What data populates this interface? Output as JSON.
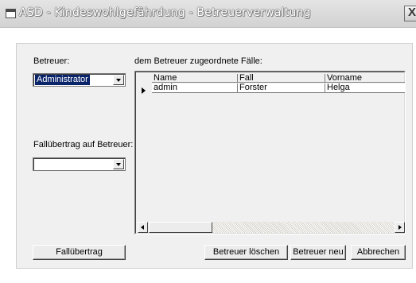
{
  "window": {
    "title": "ASD - Kindeswohlgefährdung - Betreuerverwaltung",
    "close_glyph": "X"
  },
  "left": {
    "betreuer_label": "Betreuer:",
    "betreuer_value": "Administrator",
    "transfer_label": "Fallübertrag auf Betreuer:",
    "transfer_value": ""
  },
  "cases": {
    "label": "dem Betreuer zugeordnete Fälle:",
    "columns": [
      "Name",
      "Fall",
      "Vorname"
    ],
    "rows": [
      [
        "admin",
        "Forster",
        "Helga"
      ]
    ]
  },
  "buttons": {
    "transfer": "Fallübertrag",
    "delete": "Betreuer löschen",
    "new": "Betreuer neu",
    "cancel": "Abbrechen"
  },
  "icons": {
    "app": "window-app-icon",
    "close": "close-icon",
    "row_marker": "current-row-arrow-icon",
    "dropdown": "chevron-down-icon",
    "scroll_left": "scroll-left-arrow-icon",
    "scroll_right": "scroll-right-arrow-icon"
  },
  "colors": {
    "selection": "#0a246a",
    "face": "#ececec",
    "panel": "#f0f0f0"
  }
}
